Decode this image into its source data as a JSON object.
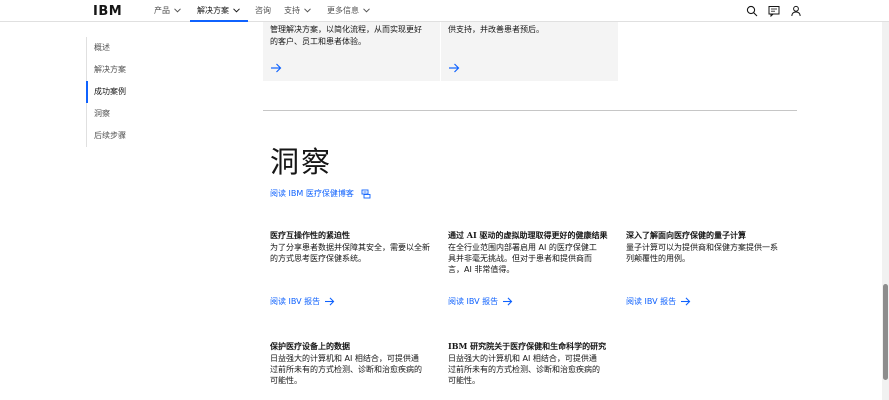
{
  "header": {
    "logo": "IBM",
    "nav": [
      {
        "label": "产品",
        "chevron": true
      },
      {
        "label": "解决方案",
        "chevron": true
      },
      {
        "label": "咨询",
        "chevron": false
      },
      {
        "label": "支持",
        "chevron": true
      },
      {
        "label": "更多信息",
        "chevron": true
      }
    ],
    "active_nav": "解决方案",
    "icons": [
      "search-icon",
      "chat-icon",
      "user-icon"
    ]
  },
  "sidebar": {
    "items": [
      {
        "label": "概述"
      },
      {
        "label": "解决方案"
      },
      {
        "label": "成功案例"
      },
      {
        "label": "洞察"
      },
      {
        "label": "后续步骤"
      }
    ],
    "active": "成功案例"
  },
  "top_cards": [
    {
      "text_lines": [
        "管理解决方案，以简化流程，从而实现更好",
        "的客户、员工和患者体验。"
      ]
    },
    {
      "text_lines": [
        "供支持，并改善患者预后。"
      ]
    }
  ],
  "insights": {
    "title": "洞察",
    "blog_link": "阅读 IBM 医疗保健博客",
    "items": [
      {
        "title": "医疗互操作性的紧迫性",
        "desc": "为了分享患者数据并保障其安全，需要以全新的方式思考医疗保健系统。",
        "link": "阅读 IBV 报告"
      },
      {
        "title": "通过 AI 驱动的虚拟助理取得更好的健康结果",
        "desc": "在全行业范围内部署启用 AI 的医疗保健工具并非毫无挑战。但对于患者和提供商而言，AI 非常值得。",
        "link": "阅读 IBV 报告"
      },
      {
        "title": "深入了解面向医疗保健的量子计算",
        "desc": "量子计算可以为提供商和保健方案提供一系列颠覆性的用例。",
        "link": "阅读 IBV 报告"
      },
      {
        "title": "保护医疗设备上的数据",
        "desc": "日益强大的计算机和 AI 相结合，可提供通过前所未有的方式检测、诊断和治愈疾病的可能性。",
        "link": ""
      },
      {
        "title": "IBM 研究院关于医疗保健和生命科学的研究",
        "desc": "日益强大的计算机和 AI 相结合，可提供通过前所未有的方式检测、诊断和治愈疾病的可能性。",
        "link": ""
      }
    ]
  },
  "colors": {
    "accent": "#0f62fe",
    "card_bg": "#f4f4f4",
    "text": "#161616"
  }
}
